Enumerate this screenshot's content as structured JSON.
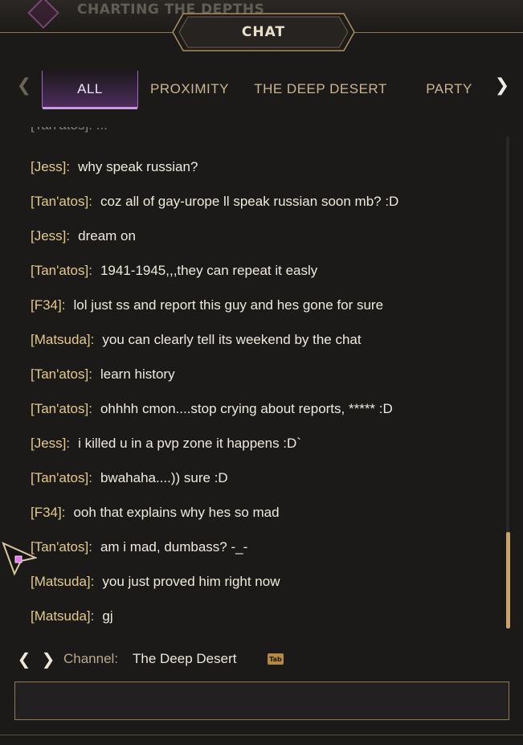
{
  "background": {
    "quest_title": "CHARTING THE DEPTHS"
  },
  "header": {
    "title": "CHAT"
  },
  "tabs": [
    {
      "label": "ALL",
      "active": true
    },
    {
      "label": "PROXIMITY",
      "active": false
    },
    {
      "label": "THE DEEP DESERT",
      "active": false
    },
    {
      "label": "PARTY",
      "active": false
    }
  ],
  "messages": [
    {
      "author": "[Jess]:",
      "text": "why speak russian?"
    },
    {
      "author": "[Tan'atos]:",
      "text": "coz all of gay-urope ll speak russian soon mb? :D"
    },
    {
      "author": "[Jess]:",
      "text": "dream on"
    },
    {
      "author": "[Tan'atos]:",
      "text": "1941-1945,,,they can repeat it easly"
    },
    {
      "author": "[F34]:",
      "text": "lol just ss and report this guy and hes gone for sure"
    },
    {
      "author": "[Matsuda]:",
      "text": "you can clearly tell its weekend by the chat"
    },
    {
      "author": "[Tan'atos]:",
      "text": "learn history"
    },
    {
      "author": "[Tan'atos]:",
      "text": "ohhhh cmon....stop crying about reports, ***** :D"
    },
    {
      "author": "[Jess]:",
      "text": "i killed u in a pvp zone it happens :D`"
    },
    {
      "author": "[Tan'atos]:",
      "text": "bwahaha....)) sure :D"
    },
    {
      "author": "[F34]:",
      "text": "ooh that explains why hes so mad"
    },
    {
      "author": "[Tan'atos]:",
      "text": "am i mad, dumbass? -_-"
    },
    {
      "author": "[Matsuda]:",
      "text": "you just proved him right now"
    },
    {
      "author": "[Matsuda]:",
      "text": "gj"
    }
  ],
  "channel": {
    "label": "Channel:",
    "value": "The Deep Desert",
    "key_hint": "Tab"
  },
  "input": {
    "value": "",
    "placeholder": ""
  },
  "colors": {
    "accent_gold": "#c9a36a",
    "active_tab_purple": "#9b6bb8",
    "author_color": "#e3c98d"
  },
  "icons": {
    "tab_prev": "chevron-left-icon",
    "tab_next": "chevron-right-icon",
    "channel_prev": "chevron-left-icon",
    "channel_next": "chevron-right-icon",
    "mouse_cursor": "cursor-arrow-icon"
  }
}
